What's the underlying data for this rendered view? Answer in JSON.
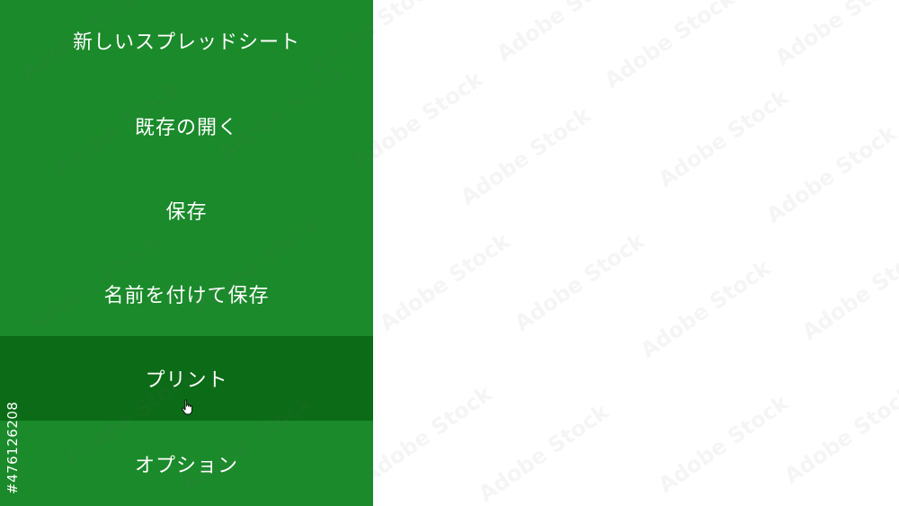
{
  "menu": {
    "items": [
      {
        "label": "新しいスプレッドシート"
      },
      {
        "label": "既存の開く"
      },
      {
        "label": "保存"
      },
      {
        "label": "名前を付けて保存"
      },
      {
        "label": "プリント"
      },
      {
        "label": "オプション"
      }
    ]
  },
  "watermark": {
    "text": "Adobe Stock",
    "id": "#476126208"
  },
  "colors": {
    "sidebar": "#1a8a2a",
    "hover": "#0b6b16",
    "text": "#ffffff",
    "background": "#ffffff"
  },
  "cursor": {
    "icon": "hand-pointer-icon"
  }
}
